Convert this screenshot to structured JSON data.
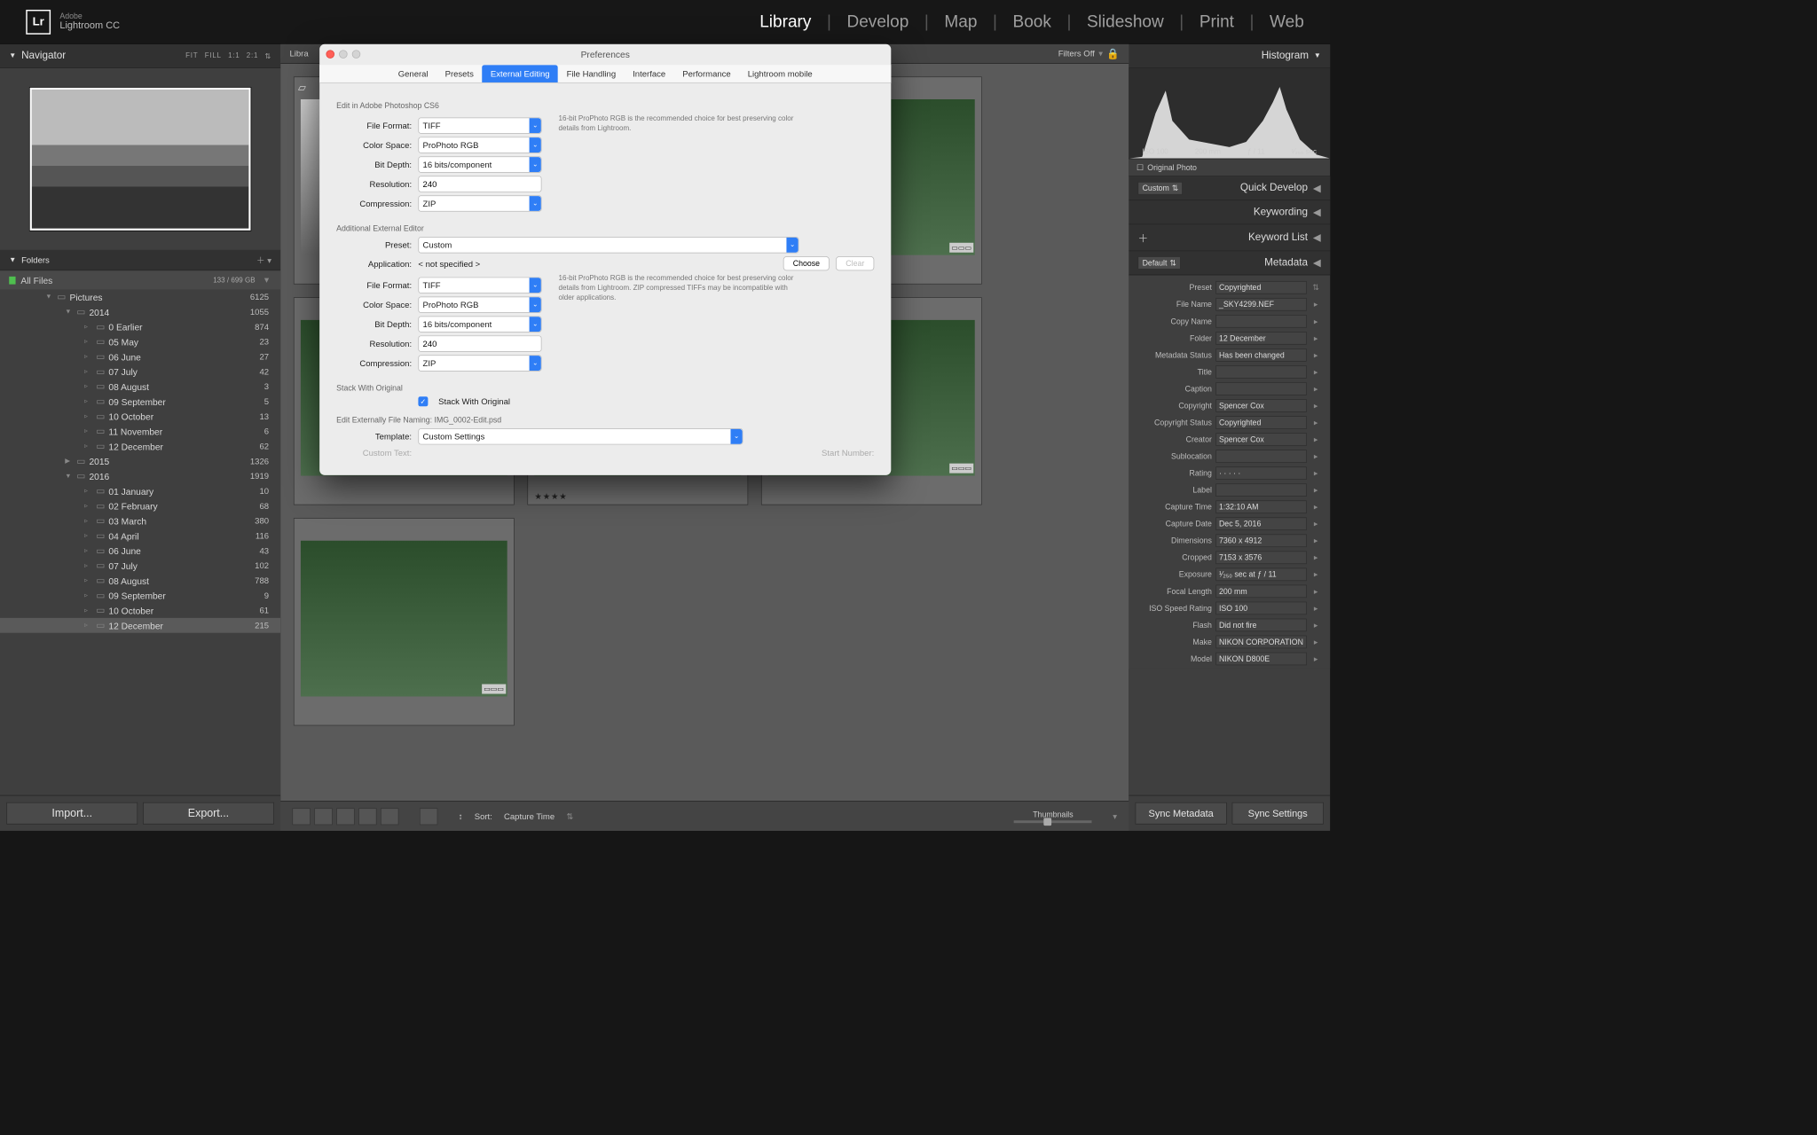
{
  "app": {
    "badge": "Lr",
    "vendor": "Adobe",
    "name": "Lightroom CC"
  },
  "modules": [
    "Library",
    "Develop",
    "Map",
    "Book",
    "Slideshow",
    "Print",
    "Web"
  ],
  "active_module": "Library",
  "navigator": {
    "title": "Navigator",
    "zoom_opts": [
      "FIT",
      "FILL",
      "1:1",
      "2:1"
    ]
  },
  "folders_panel_title": "Folders",
  "all_files": {
    "label": "All Files",
    "stat": "133 / 699 GB"
  },
  "folders": [
    {
      "depth": 1,
      "name": "Pictures",
      "count": 6125,
      "open": true
    },
    {
      "depth": 2,
      "name": "2014",
      "count": 1055,
      "open": true
    },
    {
      "depth": 3,
      "name": "0 Earlier",
      "count": 874
    },
    {
      "depth": 3,
      "name": "05 May",
      "count": 23
    },
    {
      "depth": 3,
      "name": "06 June",
      "count": 27
    },
    {
      "depth": 3,
      "name": "07 July",
      "count": 42
    },
    {
      "depth": 3,
      "name": "08 August",
      "count": 3
    },
    {
      "depth": 3,
      "name": "09 September",
      "count": 5
    },
    {
      "depth": 3,
      "name": "10 October",
      "count": 13
    },
    {
      "depth": 3,
      "name": "11 November",
      "count": 6
    },
    {
      "depth": 3,
      "name": "12 December",
      "count": 62
    },
    {
      "depth": 2,
      "name": "2015",
      "count": 1326,
      "open": false
    },
    {
      "depth": 2,
      "name": "2016",
      "count": 1919,
      "open": true
    },
    {
      "depth": 3,
      "name": "01 January",
      "count": 10
    },
    {
      "depth": 3,
      "name": "02 February",
      "count": 68
    },
    {
      "depth": 3,
      "name": "03 March",
      "count": 380
    },
    {
      "depth": 3,
      "name": "04 April",
      "count": 116
    },
    {
      "depth": 3,
      "name": "06 June",
      "count": 43
    },
    {
      "depth": 3,
      "name": "07 July",
      "count": 102
    },
    {
      "depth": 3,
      "name": "08 August",
      "count": 788
    },
    {
      "depth": 3,
      "name": "09 September",
      "count": 9
    },
    {
      "depth": 3,
      "name": "10 October",
      "count": 61
    },
    {
      "depth": 3,
      "name": "12 December",
      "count": 215,
      "selected": true
    }
  ],
  "import_label": "Import...",
  "export_label": "Export...",
  "center": {
    "breadcrumb_prefix": "Libra",
    "filters_label": "Filters Off",
    "sort_label": "Sort:",
    "sort_value": "Capture Time",
    "thumb_label": "Thumbnails"
  },
  "right": {
    "histogram_title": "Histogram",
    "readout": {
      "iso": "ISO 100",
      "focal": "200 mm",
      "aperture": "ƒ / 11",
      "shutter": "¹⁄₂₅₀ sec"
    },
    "original_photo": "Original Photo",
    "quick_develop": {
      "title": "Quick Develop",
      "preset": "Custom"
    },
    "keywording": "Keywording",
    "keyword_list": "Keyword List",
    "metadata": {
      "title": "Metadata",
      "mode": "Default",
      "preset_label": "Preset",
      "preset": "Copyrighted",
      "rows": [
        {
          "lbl": "File Name",
          "val": "_SKY4299.NEF"
        },
        {
          "lbl": "Copy Name",
          "val": ""
        },
        {
          "lbl": "Folder",
          "val": "12 December"
        },
        {
          "lbl": "Metadata Status",
          "val": "Has been changed"
        },
        {
          "lbl": "Title",
          "val": ""
        },
        {
          "lbl": "Caption",
          "val": ""
        },
        {
          "lbl": "Copyright",
          "val": "Spencer Cox"
        },
        {
          "lbl": "Copyright Status",
          "val": "Copyrighted"
        },
        {
          "lbl": "Creator",
          "val": "Spencer Cox"
        },
        {
          "lbl": "Sublocation",
          "val": ""
        },
        {
          "lbl": "Rating",
          "val": "·  ·  ·  ·  ·"
        },
        {
          "lbl": "Label",
          "val": ""
        },
        {
          "lbl": "Capture Time",
          "val": "1:32:10 AM"
        },
        {
          "lbl": "Capture Date",
          "val": "Dec 5, 2016"
        },
        {
          "lbl": "Dimensions",
          "val": "7360 x 4912"
        },
        {
          "lbl": "Cropped",
          "val": "7153 x 3576"
        },
        {
          "lbl": "Exposure",
          "val": "¹⁄₂₅₀ sec at ƒ / 11"
        },
        {
          "lbl": "Focal Length",
          "val": "200 mm"
        },
        {
          "lbl": "ISO Speed Rating",
          "val": "ISO 100"
        },
        {
          "lbl": "Flash",
          "val": "Did not fire"
        },
        {
          "lbl": "Make",
          "val": "NIKON CORPORATION"
        },
        {
          "lbl": "Model",
          "val": "NIKON D800E"
        }
      ]
    },
    "sync_metadata": "Sync Metadata",
    "sync_settings": "Sync Settings"
  },
  "modal": {
    "title": "Preferences",
    "tabs": [
      "General",
      "Presets",
      "External Editing",
      "File Handling",
      "Interface",
      "Performance",
      "Lightroom mobile"
    ],
    "active_tab": "External Editing",
    "section1": "Edit in Adobe Photoshop CS6",
    "hint1": "16-bit ProPhoto RGB is the recommended choice for best preserving color details from Lightroom.",
    "section2": "Additional External Editor",
    "hint2": "16-bit ProPhoto RGB is the recommended choice for best preserving color details from Lightroom. ZIP compressed TIFFs may be incompatible with older applications.",
    "stack_title": "Stack With Original",
    "stack_cb": "Stack With Original",
    "naming_title": "Edit Externally File Naming:  IMG_0002-Edit.psd",
    "labels": {
      "file_format": "File Format:",
      "color_space": "Color Space:",
      "bit_depth": "Bit Depth:",
      "resolution": "Resolution:",
      "compression": "Compression:",
      "preset": "Preset:",
      "application": "Application:",
      "template": "Template:",
      "custom_text": "Custom Text:",
      "start_number": "Start Number:",
      "choose": "Choose",
      "clear": "Clear"
    },
    "values": {
      "file_format": "TIFF",
      "color_space": "ProPhoto RGB",
      "bit_depth": "16 bits/component",
      "resolution": "240",
      "compression": "ZIP",
      "preset": "Custom",
      "application": "< not specified >",
      "file_format2": "TIFF",
      "color_space2": "ProPhoto RGB",
      "bit_depth2": "16 bits/component",
      "resolution2": "240",
      "compression2": "ZIP",
      "template": "Custom Settings"
    }
  }
}
